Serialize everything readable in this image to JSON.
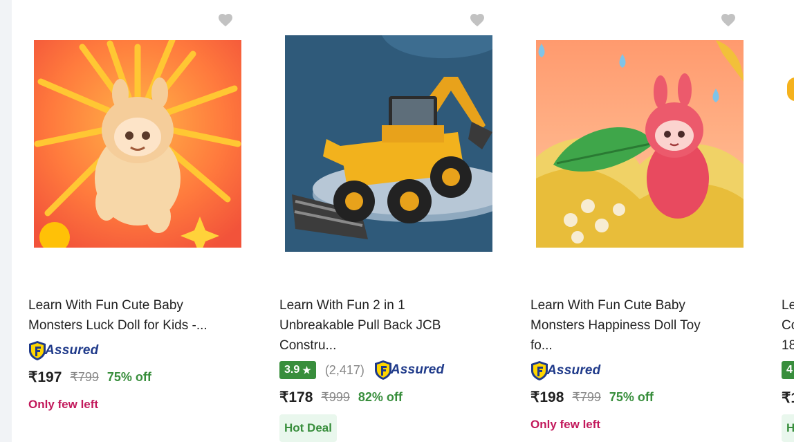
{
  "products": [
    {
      "title_line1": "Learn With Fun Cute Baby",
      "title_line2": "Monsters Luck Doll for Kids -...",
      "assured_label": "Assured",
      "price": "₹197",
      "mrp": "₹799",
      "discount": "75% off",
      "stock_note": "Only few left",
      "image_icon": "orange-luck-monster-doll"
    },
    {
      "title_line1": "Learn With Fun 2 in 1",
      "title_line2": "Unbreakable Pull Back JCB",
      "title_line3": "Constru...",
      "rating": "3.9",
      "rating_star": "★",
      "reviews": "(2,417)",
      "assured_label": "Assured",
      "price": "₹178",
      "mrp": "₹999",
      "discount": "82% off",
      "deal_badge": "Hot Deal",
      "image_icon": "yellow-backhoe-loader-toy"
    },
    {
      "title_line1": "Learn With Fun Cute Baby",
      "title_line2": "Monsters Happiness Doll Toy",
      "title_line3": "fo...",
      "assured_label": "Assured",
      "price": "₹198",
      "mrp": "₹799",
      "discount": "75% off",
      "stock_note": "Only few left",
      "image_icon": "red-happiness-monster-doll"
    }
  ],
  "peek": {
    "line1": "Le",
    "line2": "Co",
    "line3": "18",
    "rating": "4",
    "price": "₹1",
    "badge": "H"
  },
  "colors": {
    "assured_blue": "#1f3a8a",
    "rating_green": "#388e3c",
    "discount_green": "#388e3c",
    "few_left": "#c2185b",
    "wishlist_heart": "#c2c2c2"
  }
}
